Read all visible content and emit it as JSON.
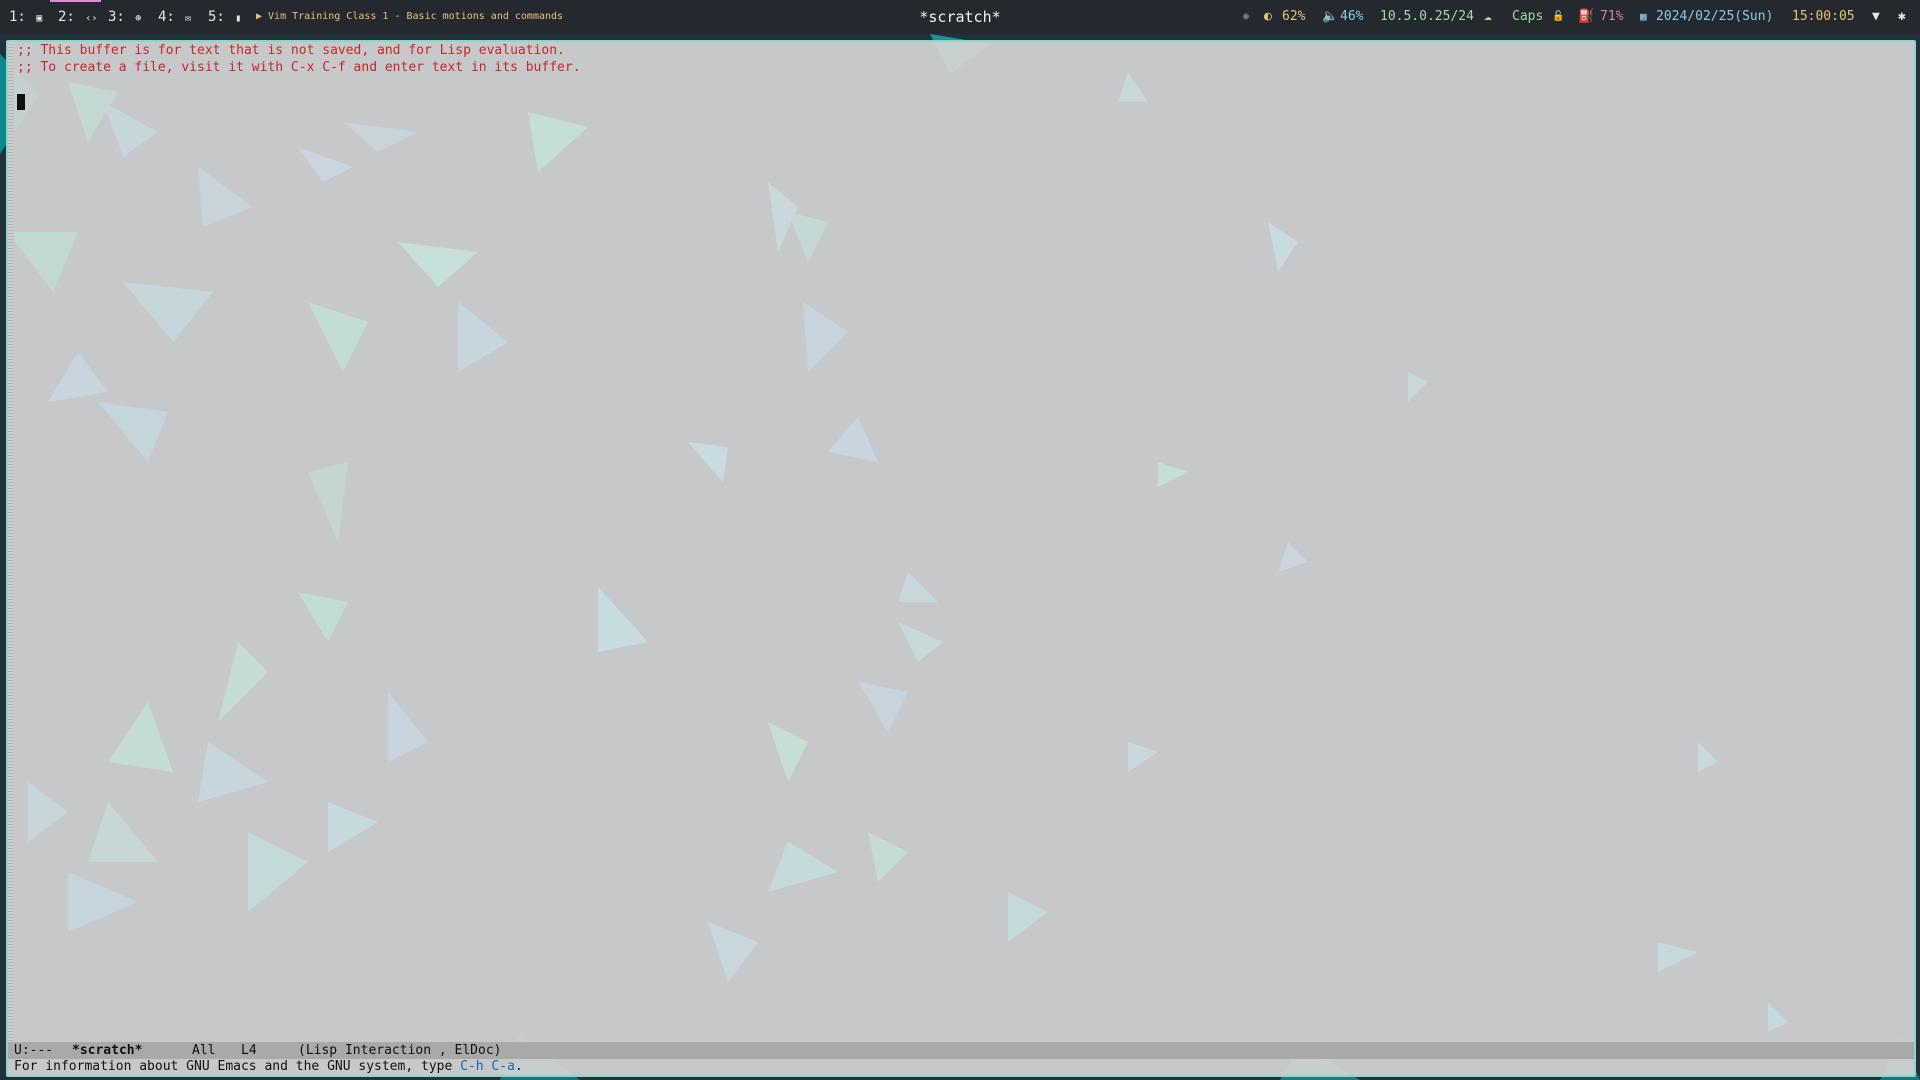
{
  "topbar": {
    "workspaces": [
      {
        "label": "1:",
        "icon": "terminal-icon",
        "glyph": "▣"
      },
      {
        "label": "2:",
        "icon": "code-icon",
        "glyph": "‹›"
      },
      {
        "label": "3:",
        "icon": "globe-icon",
        "glyph": "⊛"
      },
      {
        "label": "4:",
        "icon": "mail-icon",
        "glyph": "✉"
      },
      {
        "label": "5:",
        "icon": "file-icon",
        "glyph": "▮"
      }
    ],
    "active_workspace": "2:",
    "task": "▶ Vim Training Class 1 - Basic motions and commands",
    "title": "*scratch*",
    "stats": {
      "brightness": "62%",
      "volume": "46%",
      "ip": "10.5.0.25/24",
      "caps": "Caps",
      "battery": "71%",
      "date": "2024/02/25(Sun)",
      "time": "15:00:05"
    },
    "colors": {
      "accent": "#e08ad8",
      "brightness": "#e8c07d",
      "volume": "#8ecae6",
      "ip": "#a3d9a5",
      "caps": "#a3d9a5",
      "battery": "#e07bb6",
      "date": "#8ecae6",
      "time": "#e8c07d"
    }
  },
  "emacs": {
    "buffer_lines": [
      ";; This buffer is for text that is not saved, and for Lisp evaluation.",
      ";; To create a file, visit it with C-x C-f and enter text in its buffer."
    ],
    "modeline": {
      "status": "U:---",
      "buffer_name": "*scratch*",
      "position": "All",
      "line": "L4",
      "modes": "(Lisp Interaction , ElDoc)"
    },
    "echo_area": {
      "text": "For information about GNU Emacs and the GNU system, type ",
      "key": "C-h C-a",
      "suffix": "."
    },
    "colors": {
      "comment": "#c62828",
      "frame_border": "#8fd6c9",
      "modeline_bg": "#a9a9a9"
    }
  }
}
